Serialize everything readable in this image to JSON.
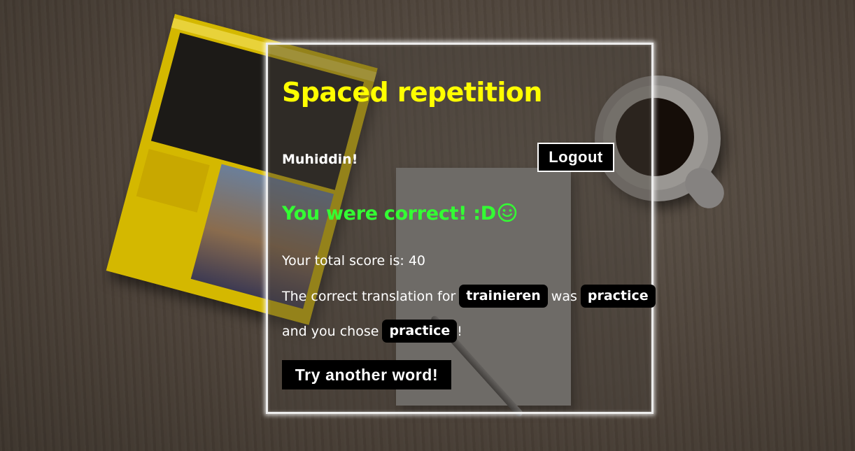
{
  "header": {
    "title": "Spaced repetition",
    "user_name": "Muhiddin!",
    "logout_label": "Logout"
  },
  "result": {
    "message": "You were correct! :D",
    "smiley_icon": "smiley-face-icon",
    "message_color": "#33ff33"
  },
  "score": {
    "label": "Your total score is:",
    "value": "40"
  },
  "translation": {
    "prefix": "The correct translation for",
    "word": "trainieren",
    "connector": "was",
    "correct_answer": "practice",
    "chosen_prefix": "and you chose",
    "chosen_answer": "practice",
    "chosen_suffix": "!"
  },
  "actions": {
    "try_another_label": "Try another word!"
  },
  "colors": {
    "title": "#ffff00",
    "accent_button": "#000000",
    "frame": "#ededed"
  }
}
